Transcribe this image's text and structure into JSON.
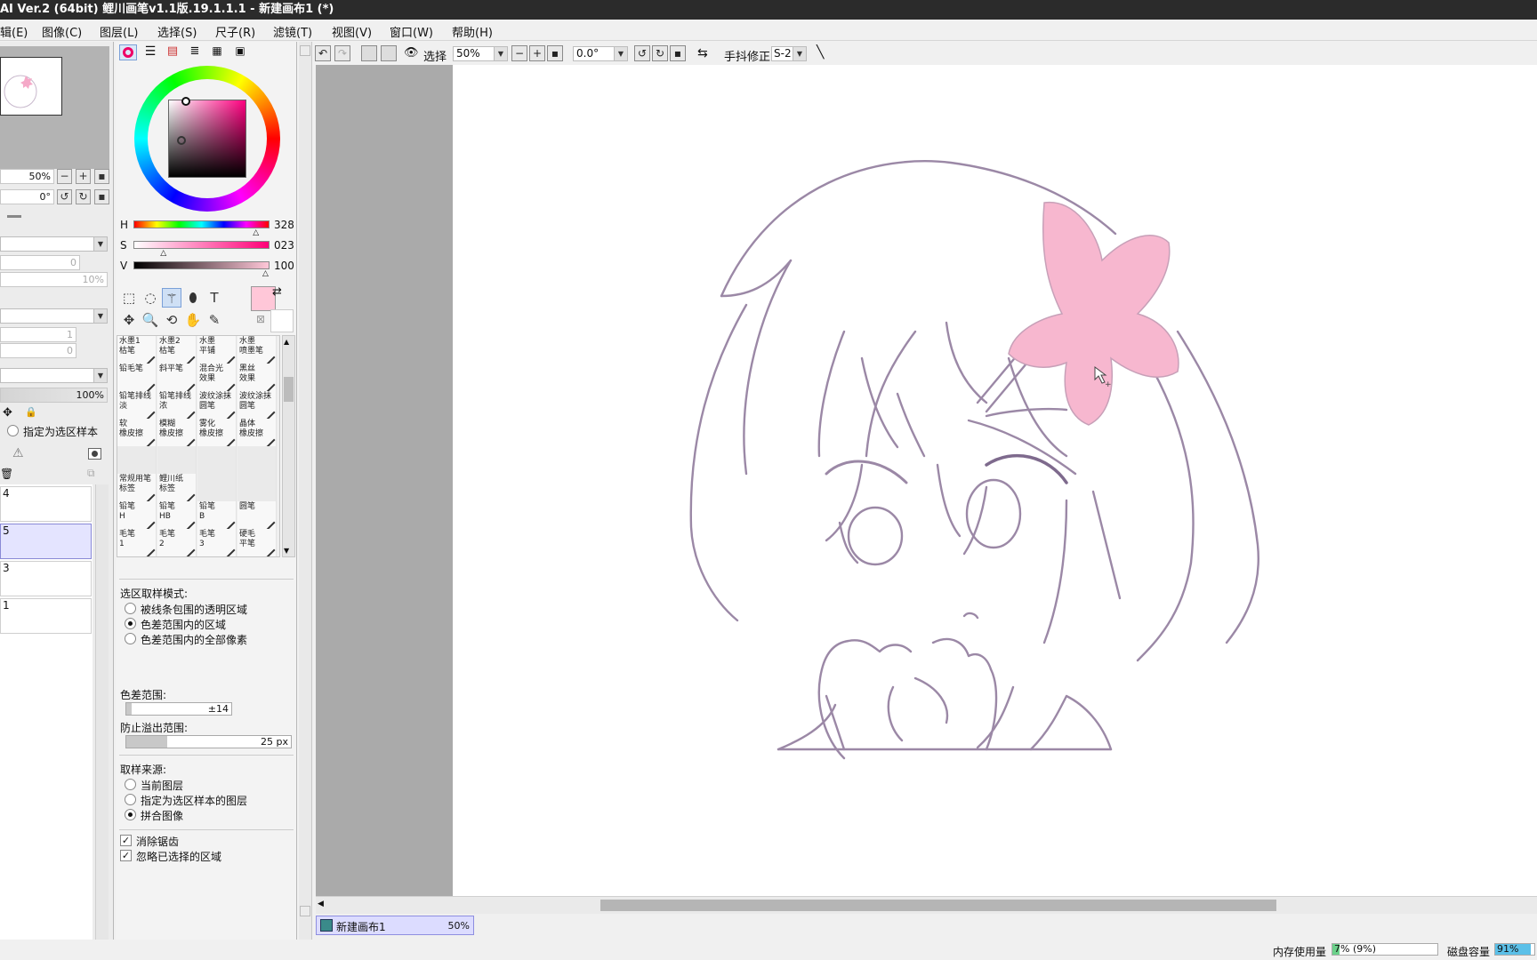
{
  "window": {
    "title": "AI Ver.2 (64bit) 鲤川画笔v1.1版.19.1.1.1 - 新建画布1 (*)"
  },
  "menu": [
    "辑(E)",
    "图像(C)",
    "图层(L)",
    "选择(S)",
    "尺子(R)",
    "滤镜(T)",
    "视图(V)",
    "窗口(W)",
    "帮助(H)"
  ],
  "navigator": {
    "zoom": "50%",
    "angle": "0°"
  },
  "layer_panel": {
    "field1": "0",
    "field2": "10%",
    "field3": "1",
    "field4": "0",
    "opacity": "100%",
    "sample_label": "指定为选区样本",
    "layers": [
      {
        "name": "4",
        "selected": false
      },
      {
        "name": "5",
        "selected": true
      },
      {
        "name": "3",
        "selected": false
      },
      {
        "name": "1",
        "selected": false
      }
    ]
  },
  "color": {
    "accent": "#ffc7d8",
    "h_label": "H",
    "h_value": "328",
    "s_label": "S",
    "s_value": "023",
    "v_label": "V",
    "v_value": "100",
    "h_level": 0.91,
    "s_level": 0.23,
    "v_level": 1.0
  },
  "tools": [
    "rect-select-icon",
    "lasso-icon",
    "magic-wand-icon",
    "bucket-icon",
    "text-icon",
    "move-icon",
    "zoom-icon",
    "rotate-icon",
    "hand-icon",
    "eyedropper-icon"
  ],
  "brushes": [
    [
      "水墨1\n枯笔",
      "水墨2\n枯笔",
      "水墨\n平铺",
      "水墨\n喷墨笔"
    ],
    [
      "铅毛笔",
      "斜平笔",
      "混合光\n效果",
      "黑丝\n效果"
    ],
    [
      "铅笔排线\n淡",
      "铅笔排线\n浓",
      "波纹涂抹\n圆笔",
      "波纹涂抹\n圆笔"
    ],
    [
      "软\n橡皮擦",
      "模糊\n橡皮擦",
      "雾化\n橡皮擦",
      "晶体\n橡皮擦"
    ],
    [
      "",
      "",
      "",
      ""
    ],
    [
      "常规用笔\n标签",
      "鲤川纸\n标签",
      "",
      ""
    ],
    [
      "铅笔\nH",
      "铅笔\nHB",
      "铅笔\nB",
      "圆笔"
    ],
    [
      "毛笔\n1",
      "毛笔\n2",
      "毛笔\n3",
      "硬毛\n平笔"
    ]
  ],
  "options": {
    "mode_title": "选区取样模式:",
    "mode": [
      "被线条包围的透明区域",
      "色差范围内的区域",
      "色差范围内的全部像素"
    ],
    "mode_selected": 1,
    "tolerance_label": "色差范围:",
    "tolerance_value": "±14",
    "overflow_label": "防止溢出范围:",
    "overflow_value": "25 px",
    "source_title": "取样来源:",
    "source": [
      "当前图层",
      "指定为选区样本的图层",
      "拼合图像"
    ],
    "source_selected": 2,
    "antialias": "消除锯齿",
    "ignore_selected": "忽略已选择的区域"
  },
  "canvas_toolbar": {
    "select_label": "选择",
    "zoom": "50%",
    "angle": "0.0°",
    "stabilizer_label": "手抖修正",
    "stabilizer": "S-2"
  },
  "doc_tab": {
    "name": "新建画布1",
    "zoom": "50%"
  },
  "status": {
    "mem_label": "内存使用量",
    "mem_value": "7% (9%)",
    "mem_level": 0.07,
    "disk_label": "磁盘容量",
    "disk_value": "91%",
    "disk_level": 0.91
  }
}
